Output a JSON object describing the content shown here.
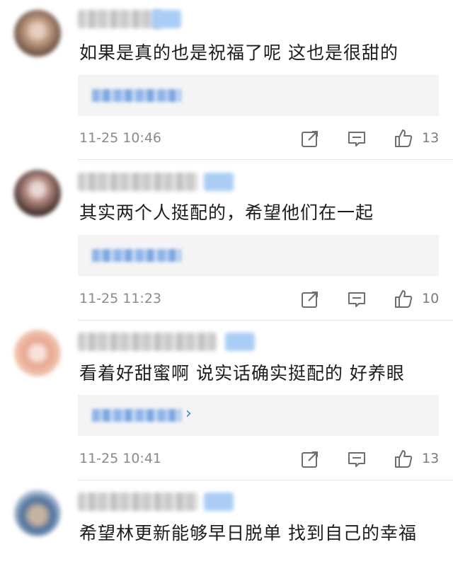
{
  "comments": [
    {
      "text": "如果是真的也是祝福了呢 这也是很甜的",
      "time": "11-25 10:46",
      "likes": "13",
      "avatar_colors": [
        "#6b5141",
        "#c9a58a",
        "#e4cfc1"
      ],
      "reply_has_chevron": false
    },
    {
      "text": "其实两个人挺配的，希望他们在一起",
      "time": "11-25 11:23",
      "likes": "10",
      "avatar_colors": [
        "#3d2b26",
        "#b88e86",
        "#e8d8d6"
      ],
      "reply_has_chevron": false
    },
    {
      "text": "看着好甜蜜啊 说实话确实挺配的 好养眼",
      "time": "11-25 10:41",
      "likes": "13",
      "avatar_colors": [
        "#f0c9b2",
        "#e8a58f",
        "#f7e3d8"
      ],
      "reply_has_chevron": true,
      "reply_chevron": "›"
    },
    {
      "text": "希望林更新能够早日脱单 找到自己的幸福",
      "avatar_colors": [
        "#4a6e9a",
        "#c7b3a0",
        "#e5eef6"
      ]
    }
  ],
  "icons": {
    "share": "share-icon",
    "reply": "comment-icon",
    "like": "thumbs-up-icon"
  }
}
